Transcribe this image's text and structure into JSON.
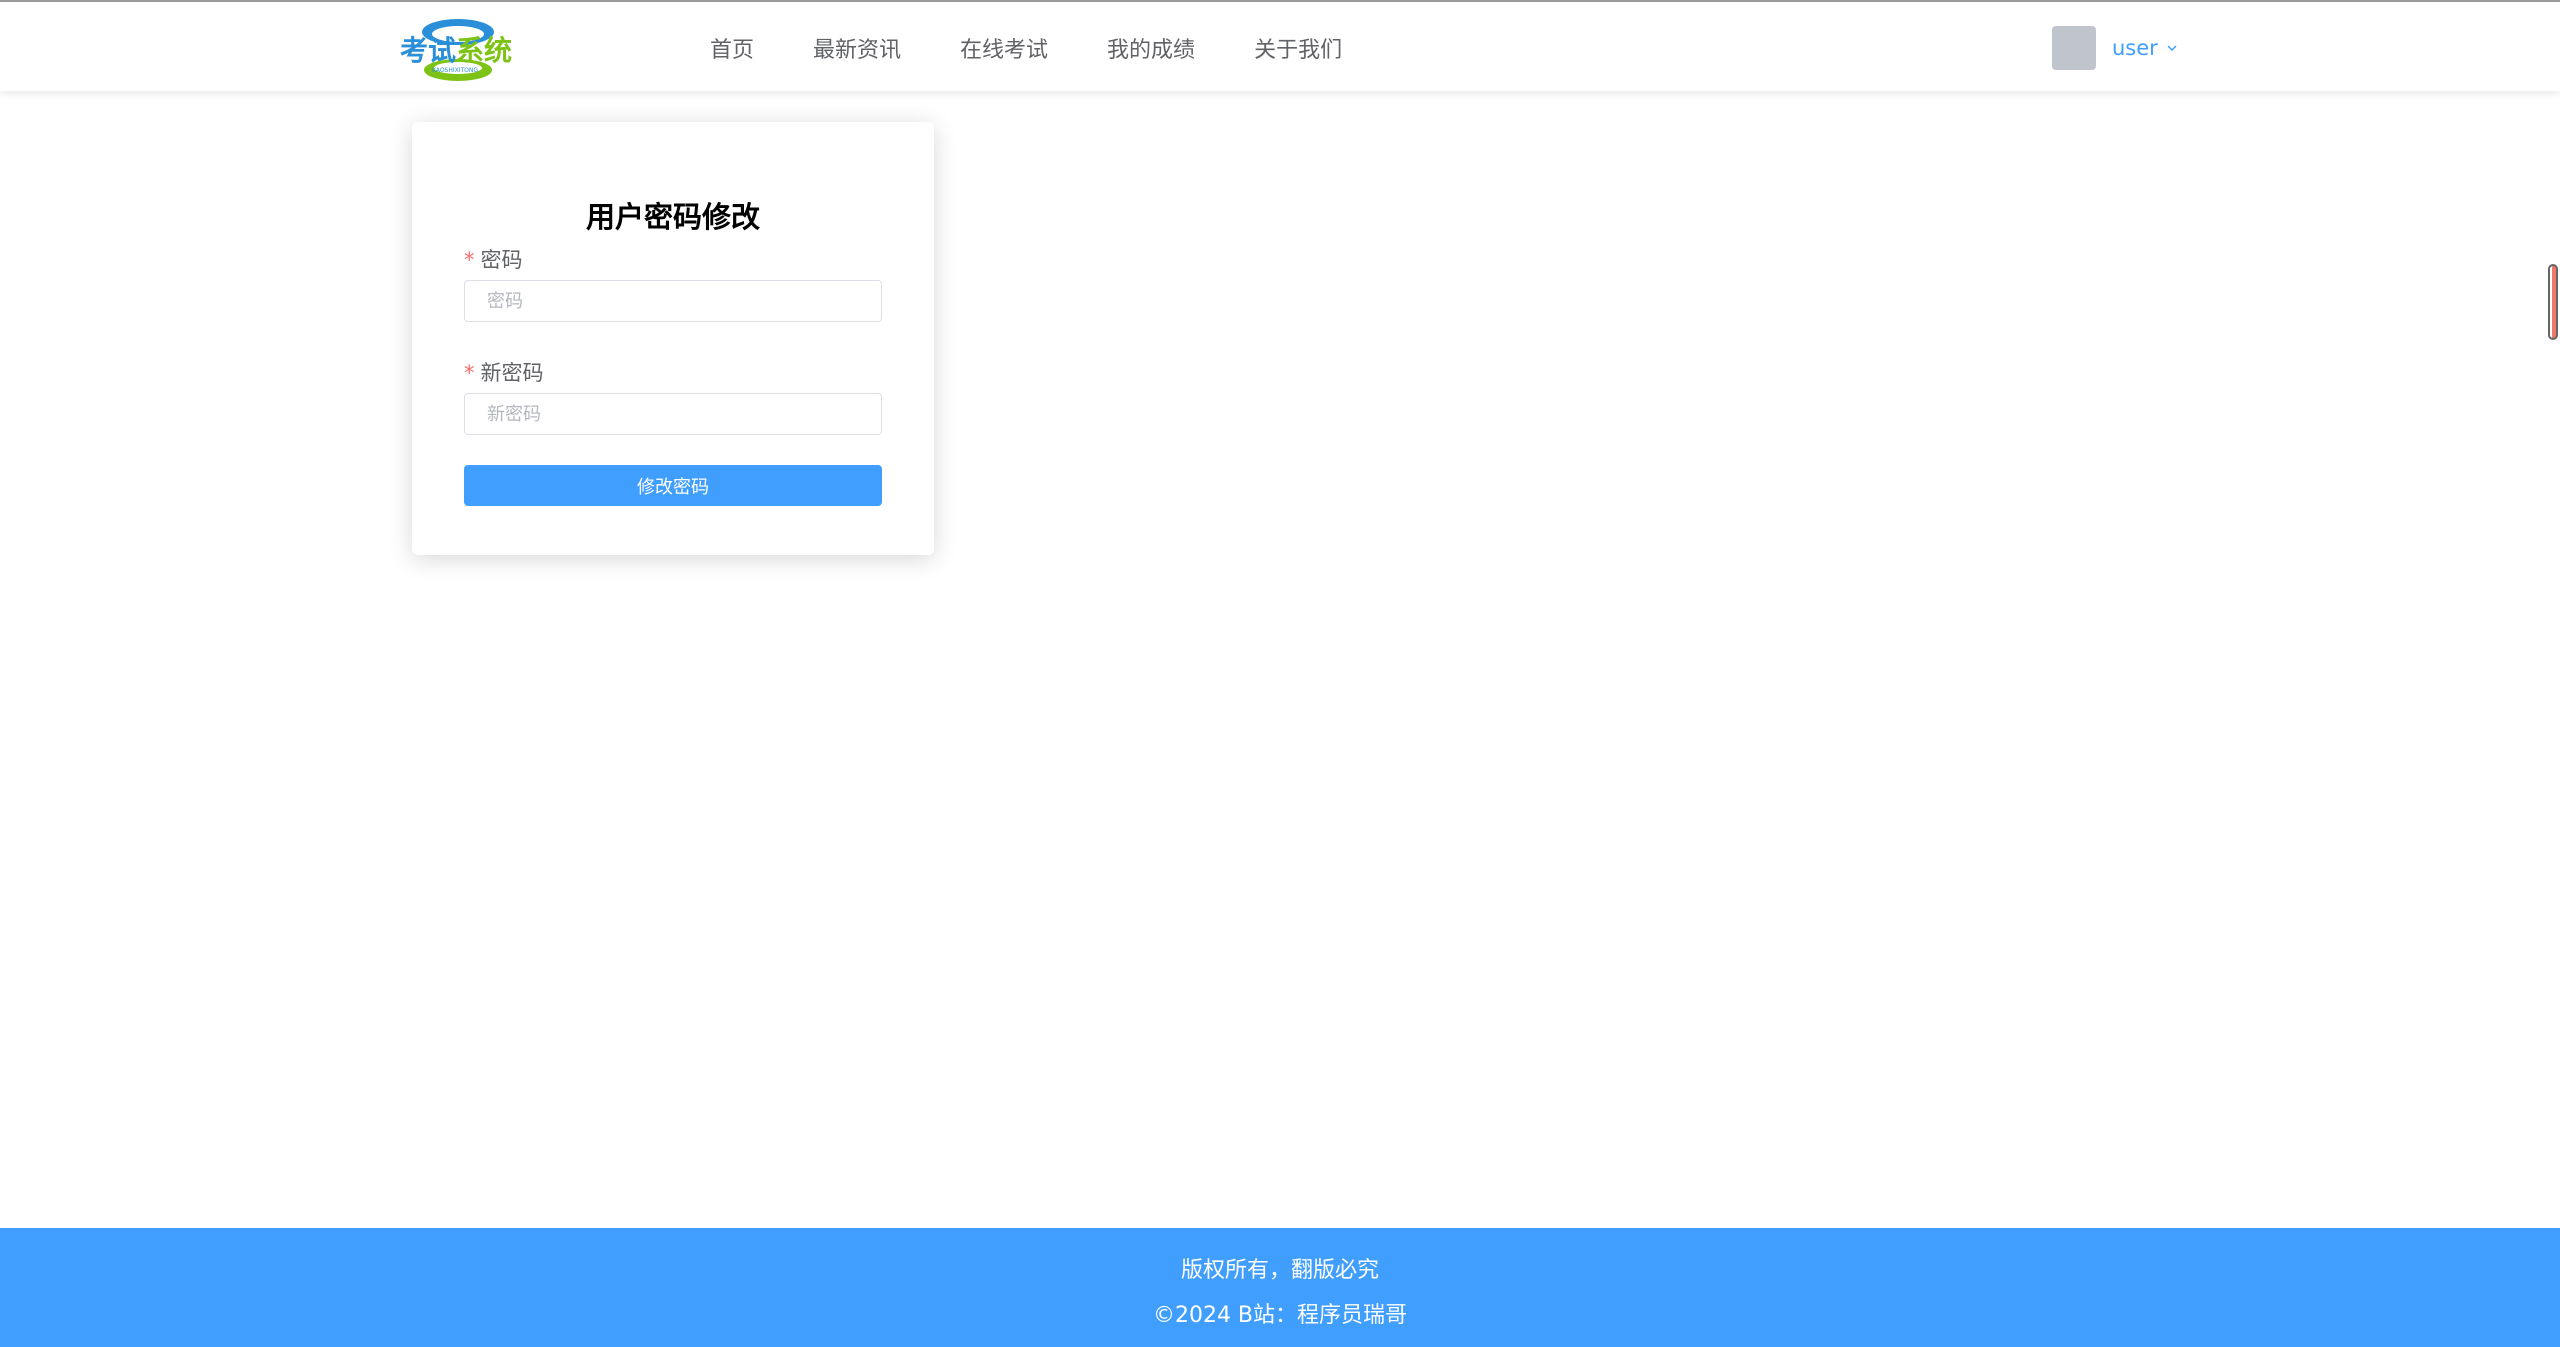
{
  "header": {
    "logo_text": "考试系统",
    "logo_subtext": "KAOSHIXITONG",
    "nav": [
      {
        "label": "首页"
      },
      {
        "label": "最新资讯"
      },
      {
        "label": "在线考试"
      },
      {
        "label": "我的成绩"
      },
      {
        "label": "关于我们"
      }
    ],
    "user": {
      "name": "user",
      "dropdown_icon": "chevron-down-icon"
    }
  },
  "form": {
    "title": "用户密码修改",
    "password": {
      "label": "密码",
      "placeholder": "密码",
      "value": ""
    },
    "new_password": {
      "label": "新密码",
      "placeholder": "新密码",
      "value": ""
    },
    "required_mark": "*",
    "submit_label": "修改密码"
  },
  "footer": {
    "line1": "版权所有，翻版必究",
    "line2": "©2024 B站：程序员瑞哥"
  },
  "colors": {
    "primary": "#409eff",
    "required": "#f56c6c",
    "logo_blue": "#2a8fd8",
    "logo_green": "#7cc316"
  }
}
